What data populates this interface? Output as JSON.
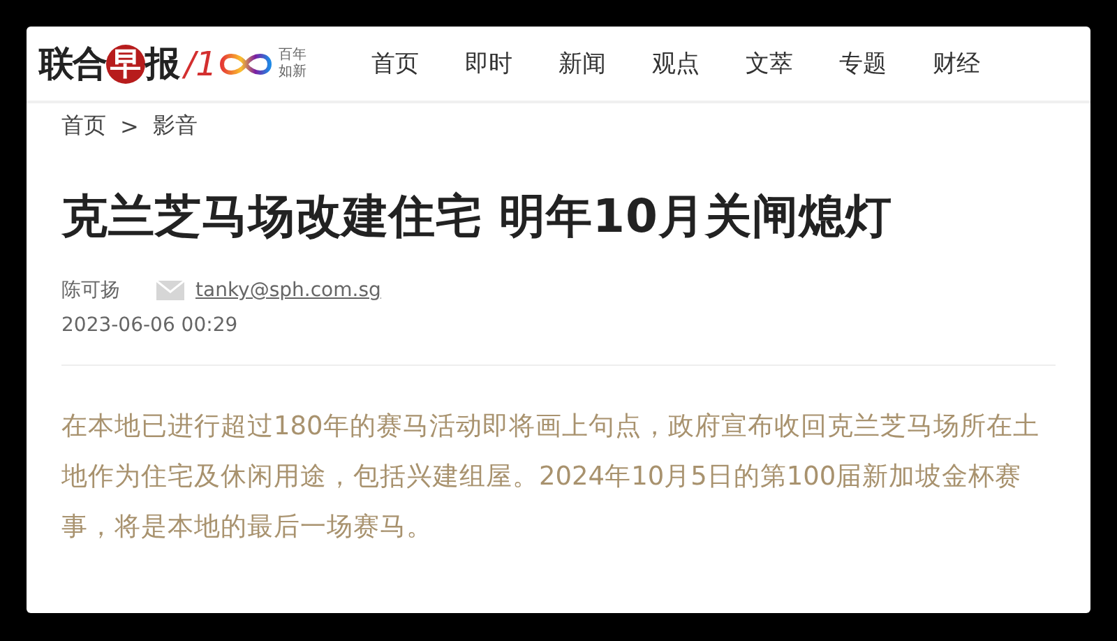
{
  "logo": {
    "name_start": "联合",
    "name_mark": "早",
    "name_end": "报",
    "anniversary": "/1",
    "tagline": [
      "百年",
      "如新"
    ]
  },
  "nav": [
    {
      "label": "首页"
    },
    {
      "label": "即时"
    },
    {
      "label": "新闻"
    },
    {
      "label": "观点"
    },
    {
      "label": "文萃"
    },
    {
      "label": "专题"
    },
    {
      "label": "财经"
    }
  ],
  "breadcrumb": [
    "首页",
    "影音"
  ],
  "breadcrumb_separator": ">",
  "article": {
    "title": "克兰芝马场改建住宅 明年10月关闸熄灯",
    "author": "陈可扬",
    "email": "tanky@sph.com.sg",
    "date": "2023-06-06 00:29",
    "lede": "在本地已进行超过180年的赛马活动即将画上句点，政府宣布收回克兰芝马场所在土地作为住宅及休闲用途，包括兴建组屋。2024年10月5日的第100届新加坡金杯赛事，将是本地的最后一场赛马。"
  }
}
